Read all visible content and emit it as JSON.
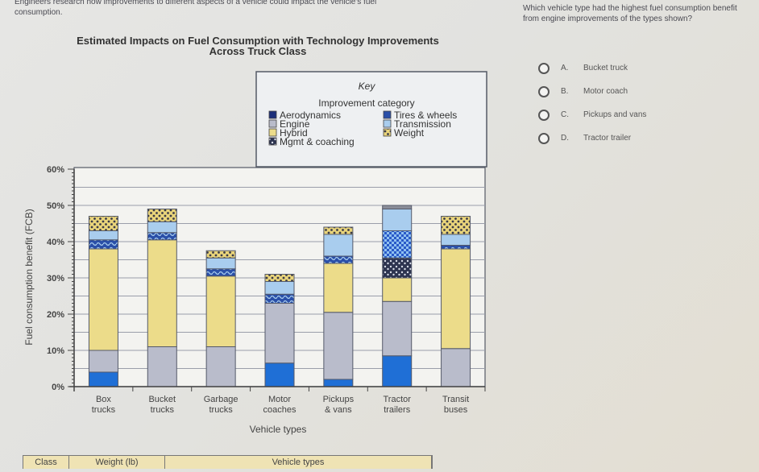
{
  "intro_text": "Engineers research how improvements to different aspects of a vehicle could impact the vehicle's fuel consumption.",
  "question": {
    "text": "Which vehicle type had the highest fuel consumption benefit from engine improvements of the types shown?",
    "options": [
      {
        "letter": "A.",
        "label": "Bucket truck"
      },
      {
        "letter": "B.",
        "label": "Motor coach"
      },
      {
        "letter": "C.",
        "label": "Pickups and vans"
      },
      {
        "letter": "D.",
        "label": "Tractor trailer"
      }
    ]
  },
  "chart_data": {
    "type": "bar",
    "stacked": true,
    "title": "Estimated Impacts on Fuel Consumption with Technology Improvements",
    "subtitle": "Across Truck Class",
    "xlabel": "Vehicle types",
    "ylabel": "Fuel consumption benefit (FCB)",
    "ylim": [
      0,
      60
    ],
    "yticks": [
      "0%",
      "10%",
      "20%",
      "30%",
      "40%",
      "50%",
      "60%"
    ],
    "grid": true,
    "legend": {
      "title": "Key",
      "subtitle": "Improvement category",
      "placement": "top-center"
    },
    "categories": [
      [
        "Box",
        "trucks"
      ],
      [
        "Bucket",
        "trucks"
      ],
      [
        "Garbage",
        "trucks"
      ],
      [
        "Motor",
        "coaches"
      ],
      [
        "Pickups",
        "& vans"
      ],
      [
        "Tractor",
        "trailers"
      ],
      [
        "Transit",
        "buses"
      ]
    ],
    "series": [
      {
        "name": "Aerodynamics",
        "color": "#1f6fd6",
        "pattern": "solid",
        "values": [
          4,
          0,
          0,
          6.5,
          2,
          8.5,
          0
        ]
      },
      {
        "name": "Engine",
        "color": "#b9bccb",
        "pattern": "solid",
        "values": [
          6,
          11,
          11,
          16.5,
          18.5,
          15,
          10.5
        ]
      },
      {
        "name": "Hybrid",
        "color": "#ecdc8a",
        "pattern": "solid",
        "values": [
          28,
          29.5,
          19.5,
          0,
          13.5,
          6.5,
          27.5
        ]
      },
      {
        "name": "Mgmt & coaching",
        "color": "#2d3450",
        "pattern": "dots-light",
        "values": [
          0,
          0,
          0,
          0,
          0,
          5.5,
          0
        ]
      },
      {
        "name": "Tires & wheels",
        "color": "#2a4fa8",
        "pattern": "waves",
        "values": [
          2.5,
          2,
          2,
          2.5,
          2,
          7.5,
          1
        ]
      },
      {
        "name": "Transmission",
        "color": "#a9cdee",
        "pattern": "solid",
        "values": [
          2.5,
          3,
          3,
          3.5,
          6,
          6,
          3
        ]
      },
      {
        "name": "Weight",
        "color": "#e9d47a",
        "pattern": "dots-dark",
        "values": [
          4,
          3.5,
          2,
          2,
          2,
          1,
          5
        ]
      }
    ]
  },
  "bottom_table": {
    "headers": [
      "Class",
      "Weight (lb)",
      "Vehicle types"
    ]
  }
}
